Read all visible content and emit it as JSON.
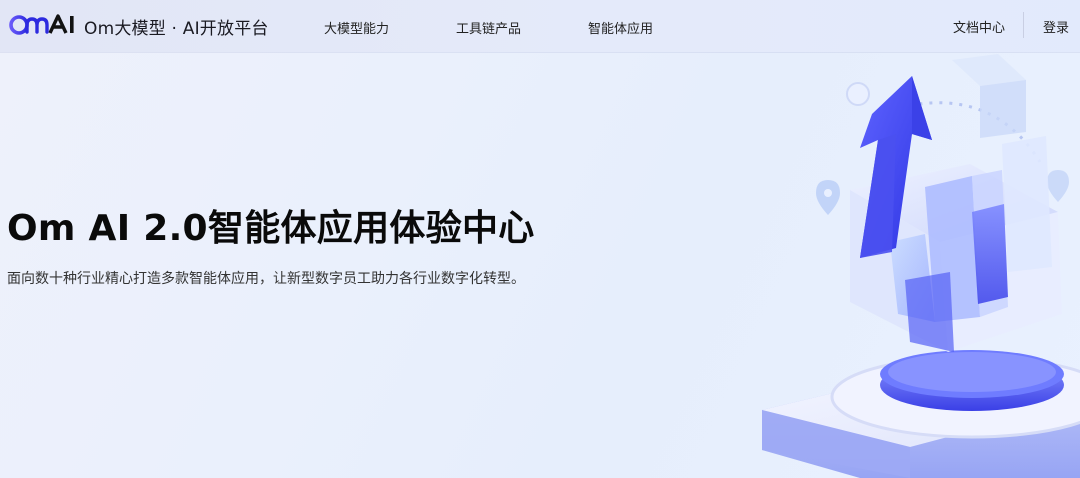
{
  "navbar": {
    "logo_text": "OmAI",
    "brand_title": "Om大模型 · AI开放平台",
    "items": [
      {
        "label": "大模型能力"
      },
      {
        "label": "工具链产品"
      },
      {
        "label": "智能体应用"
      }
    ],
    "docs_label": "文档中心",
    "login_label": "登录"
  },
  "hero": {
    "title": "Om AI 2.0智能体应用体验中心",
    "subtitle": "面向数十种行业精心打造多款智能体应用，让新型数字员工助力各行业数字化转型。"
  },
  "colors": {
    "accent": "#5b4cf0",
    "accent_light": "#7f8cff",
    "background": "#eaf0fc"
  },
  "icons": {
    "logo": "omai-logo-icon",
    "illustration": "growth-cube-illustration"
  }
}
